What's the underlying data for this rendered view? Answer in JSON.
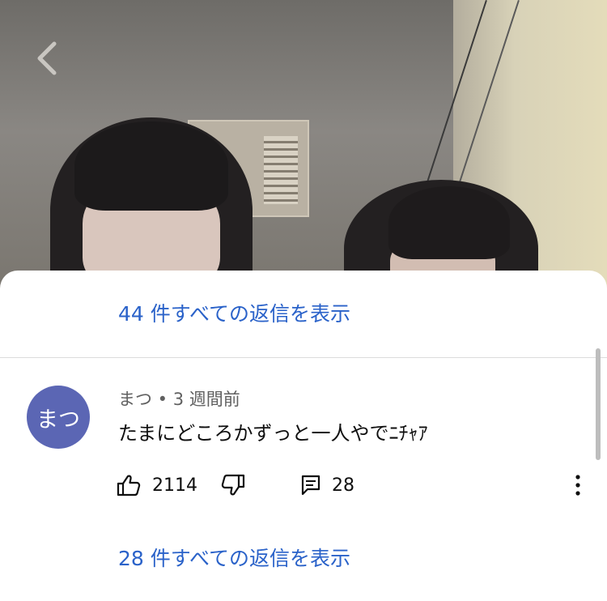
{
  "top_replies_link": {
    "count": "44",
    "label": " 件すべての返信を表示"
  },
  "comment": {
    "avatar_text": "まつ",
    "author": "まつ",
    "separator": " • ",
    "time": "3 週間前",
    "text": "たまにどころかずっと一人やでﾆﾁｬｱ",
    "like_count": "2114",
    "reply_count": "28"
  },
  "bottom_replies_link": {
    "count": "28",
    "label": " 件すべての返信を表示"
  },
  "colors": {
    "link": "#2a62c9",
    "avatar_bg": "#5b66b4"
  }
}
